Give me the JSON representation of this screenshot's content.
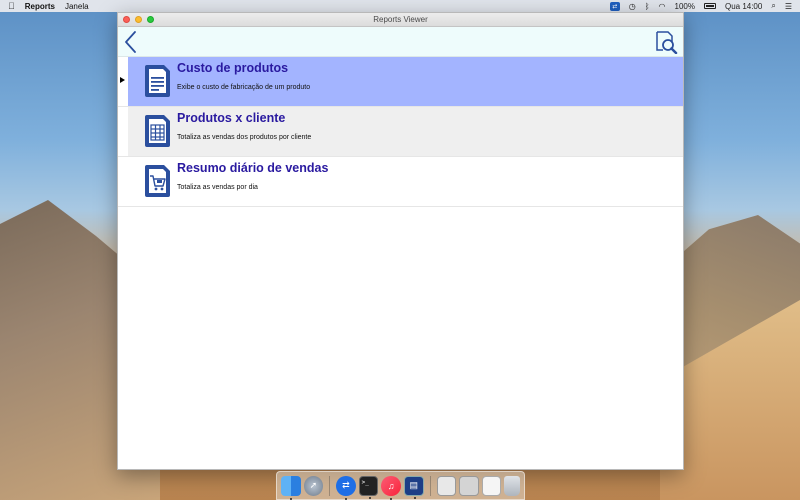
{
  "menubar": {
    "app_name": "Reports",
    "menu_items": [
      "Janela"
    ],
    "battery": "100%",
    "clock": "Qua 14:00"
  },
  "window": {
    "title": "Reports Viewer"
  },
  "reports": [
    {
      "title": "Custo de produtos",
      "description": "Exibe o custo de fabricação de um produto",
      "icon": "document-lines-icon",
      "selected": true
    },
    {
      "title": "Produtos x cliente",
      "description": "Totaliza as vendas dos produtos por cliente",
      "icon": "document-table-icon",
      "selected": false
    },
    {
      "title": "Resumo diário de vendas",
      "description": "Totaliza as vendas por dia",
      "icon": "document-cart-icon",
      "selected": false
    }
  ],
  "colors": {
    "accent_title": "#2a1aa0",
    "selected_row": "#a3b4ff",
    "icon_blue": "#2b4f9e",
    "toolbar_bg": "#eefcfc"
  },
  "dock": [
    "finder-icon",
    "launchpad-icon",
    "teamviewer-icon",
    "terminal-icon",
    "music-icon",
    "reports-icon",
    "preview-icon",
    "system-preferences-icon",
    "document-icon",
    "trash-icon"
  ]
}
